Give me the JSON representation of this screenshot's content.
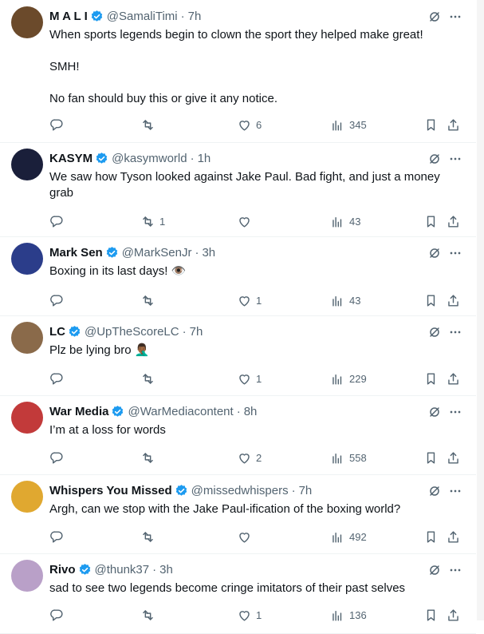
{
  "colors": {
    "verified": "#1d9bf0",
    "secondary": "#536471",
    "primary": "#0f1419",
    "divider": "#eff3f4"
  },
  "icons": {
    "reply": "reply-icon",
    "retweet": "retweet-icon",
    "like": "heart-icon",
    "views": "views-icon",
    "bookmark": "bookmark-icon",
    "share": "share-icon",
    "grok": "grok-icon",
    "more": "more-icon"
  },
  "tweets": [
    {
      "name": "M A L I",
      "verified": true,
      "handle": "@SamaliTimi",
      "time": "7h",
      "text": "When sports legends begin to clown the sport they helped make great!\n\nSMH!\n\nNo fan should buy this or give it any notice.",
      "replies": "",
      "retweets": "",
      "likes": "6",
      "views": "345",
      "avatar_color": "#6b4a2b"
    },
    {
      "name": "KASYM",
      "verified": true,
      "handle": "@kasymworld",
      "time": "1h",
      "text": "We saw how Tyson looked against Jake Paul. Bad fight, and just a money\ngrab",
      "replies": "",
      "retweets": "1",
      "likes": "",
      "views": "43",
      "avatar_color": "#1a1f3a"
    },
    {
      "name": "Mark Sen",
      "verified": true,
      "handle": "@MarkSenJr",
      "time": "3h",
      "text": "Boxing in its last days! 👁️",
      "replies": "",
      "retweets": "",
      "likes": "1",
      "views": "43",
      "avatar_color": "#2b3d8a"
    },
    {
      "name": "LC",
      "verified": true,
      "handle": "@UpTheScoreLC",
      "time": "7h",
      "text": "Plz be lying bro 🤦🏾‍♂️",
      "replies": "",
      "retweets": "",
      "likes": "1",
      "views": "229",
      "avatar_color": "#8a6a4a"
    },
    {
      "name": "War Media",
      "verified": true,
      "handle": "@WarMediacontent",
      "time": "8h",
      "text": "I’m at a loss for words",
      "replies": "",
      "retweets": "",
      "likes": "2",
      "views": "558",
      "avatar_color": "#c23a3a"
    },
    {
      "name": "Whispers You Missed",
      "verified": true,
      "handle": "@missedwhispers",
      "time": "7h",
      "text": "Argh, can we stop with the Jake Paul-ification of the boxing world?",
      "replies": "",
      "retweets": "",
      "likes": "",
      "views": "492",
      "avatar_color": "#e0a830"
    },
    {
      "name": "Rivo",
      "verified": true,
      "handle": "@thunk37",
      "time": "3h",
      "text": "sad to see two legends become cringe imitators of their past selves",
      "replies": "",
      "retweets": "",
      "likes": "1",
      "views": "136",
      "avatar_color": "#b9a0c8"
    }
  ]
}
